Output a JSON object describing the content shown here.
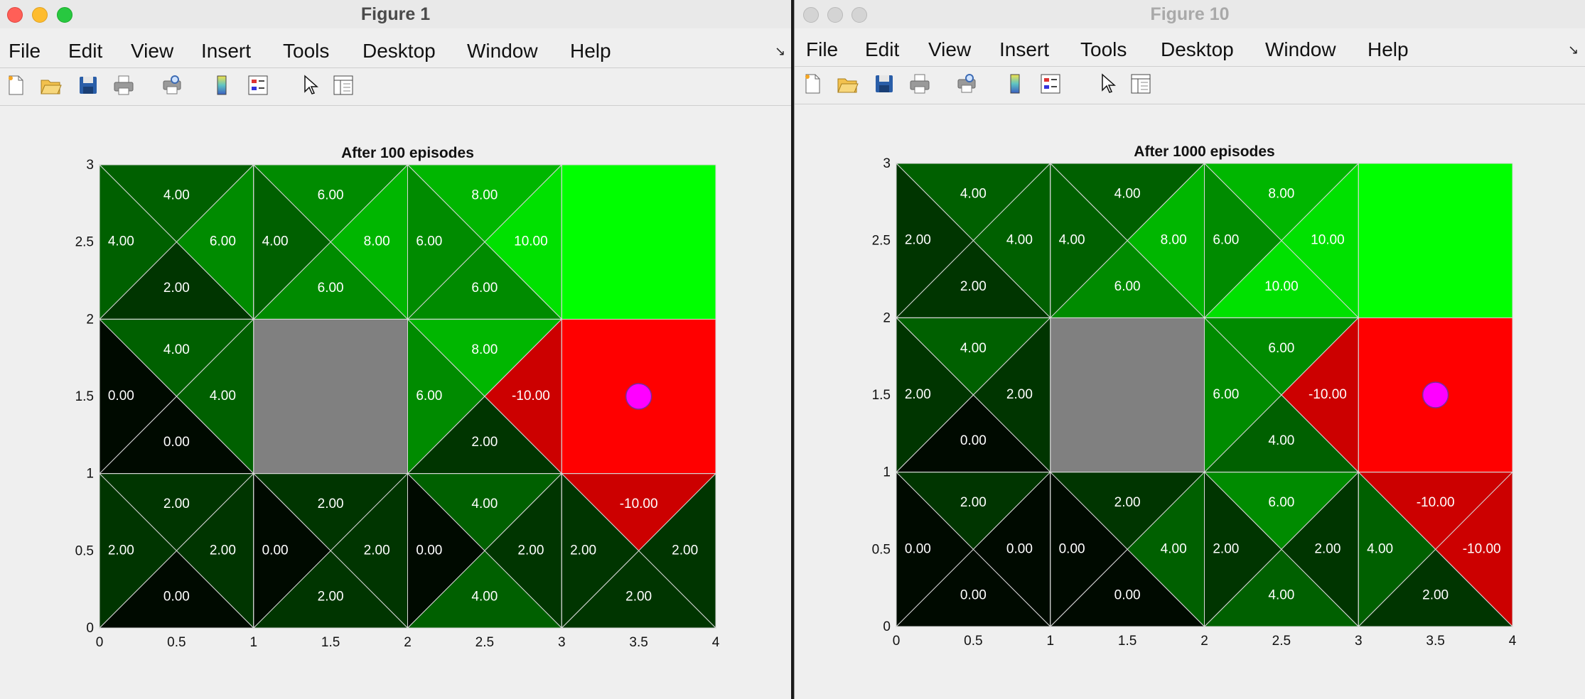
{
  "menus": [
    "File",
    "Edit",
    "View",
    "Insert",
    "Tools",
    "Desktop",
    "Window",
    "Help"
  ],
  "toolbar_icons": [
    "new-figure-icon",
    "open-file-icon",
    "save-icon",
    "print-icon",
    "print-preview-icon",
    "colorbar-icon",
    "legend-icon",
    "pointer-icon",
    "property-editor-icon"
  ],
  "colors": {
    "goal": "#00ff00",
    "trap": "#ff0000",
    "wall": "#808080",
    "agent": "#ff00ff"
  },
  "windows": [
    {
      "title": "Figure 1",
      "active": true,
      "chart_data": {
        "type": "heatmap",
        "title": "After 100 episodes",
        "xlim": [
          0,
          4
        ],
        "ylim": [
          0,
          3
        ],
        "xticks": [
          "0",
          "0.5",
          "1",
          "1.5",
          "2",
          "2.5",
          "3",
          "3.5",
          "4"
        ],
        "yticks": [
          "0",
          "0.5",
          "1",
          "1.5",
          "2",
          "2.5",
          "3"
        ],
        "goal_cell": [
          3,
          2
        ],
        "trap_cell": [
          3,
          1
        ],
        "wall_cell": [
          1,
          1
        ],
        "agent": [
          3.5,
          1.5
        ],
        "cells": [
          {
            "cell": [
              0,
              2
            ],
            "up": "4.00",
            "right": "6.00",
            "down": "2.00",
            "left": "4.00"
          },
          {
            "cell": [
              1,
              2
            ],
            "up": "6.00",
            "right": "8.00",
            "down": "6.00",
            "left": "4.00"
          },
          {
            "cell": [
              2,
              2
            ],
            "up": "8.00",
            "right": "10.00",
            "down": "6.00",
            "left": "6.00"
          },
          {
            "cell": [
              0,
              1
            ],
            "up": "4.00",
            "right": "4.00",
            "down": "0.00",
            "left": "0.00"
          },
          {
            "cell": [
              2,
              1
            ],
            "up": "8.00",
            "right": "-10.00",
            "down": "2.00",
            "left": "6.00"
          },
          {
            "cell": [
              0,
              0
            ],
            "up": "2.00",
            "right": "2.00",
            "down": "0.00",
            "left": "2.00"
          },
          {
            "cell": [
              1,
              0
            ],
            "up": "2.00",
            "right": "2.00",
            "down": "2.00",
            "left": "0.00"
          },
          {
            "cell": [
              2,
              0
            ],
            "up": "4.00",
            "right": "2.00",
            "down": "4.00",
            "left": "0.00"
          },
          {
            "cell": [
              3,
              0
            ],
            "up": "-10.00",
            "right": "2.00",
            "down": "2.00",
            "left": "2.00"
          }
        ]
      }
    },
    {
      "title": "Figure 10",
      "active": false,
      "chart_data": {
        "type": "heatmap",
        "title": "After 1000 episodes",
        "xlim": [
          0,
          4
        ],
        "ylim": [
          0,
          3
        ],
        "xticks": [
          "0",
          "0.5",
          "1",
          "1.5",
          "2",
          "2.5",
          "3",
          "3.5",
          "4"
        ],
        "yticks": [
          "0",
          "0.5",
          "1",
          "1.5",
          "2",
          "2.5",
          "3"
        ],
        "goal_cell": [
          3,
          2
        ],
        "trap_cell": [
          3,
          1
        ],
        "wall_cell": [
          1,
          1
        ],
        "agent": [
          3.5,
          1.5
        ],
        "cells": [
          {
            "cell": [
              0,
              2
            ],
            "up": "4.00",
            "right": "4.00",
            "down": "2.00",
            "left": "2.00"
          },
          {
            "cell": [
              1,
              2
            ],
            "up": "4.00",
            "right": "8.00",
            "down": "6.00",
            "left": "4.00"
          },
          {
            "cell": [
              2,
              2
            ],
            "up": "8.00",
            "right": "10.00",
            "down": "10.00",
            "left": "6.00"
          },
          {
            "cell": [
              0,
              1
            ],
            "up": "4.00",
            "right": "2.00",
            "down": "0.00",
            "left": "2.00"
          },
          {
            "cell": [
              2,
              1
            ],
            "up": "6.00",
            "right": "-10.00",
            "down": "4.00",
            "left": "6.00"
          },
          {
            "cell": [
              0,
              0
            ],
            "up": "2.00",
            "right": "0.00",
            "down": "0.00",
            "left": "0.00"
          },
          {
            "cell": [
              1,
              0
            ],
            "up": "2.00",
            "right": "4.00",
            "down": "0.00",
            "left": "0.00"
          },
          {
            "cell": [
              2,
              0
            ],
            "up": "6.00",
            "right": "2.00",
            "down": "4.00",
            "left": "2.00"
          },
          {
            "cell": [
              3,
              0
            ],
            "up": "-10.00",
            "right": "-10.00",
            "down": "2.00",
            "left": "4.00"
          }
        ]
      }
    }
  ]
}
